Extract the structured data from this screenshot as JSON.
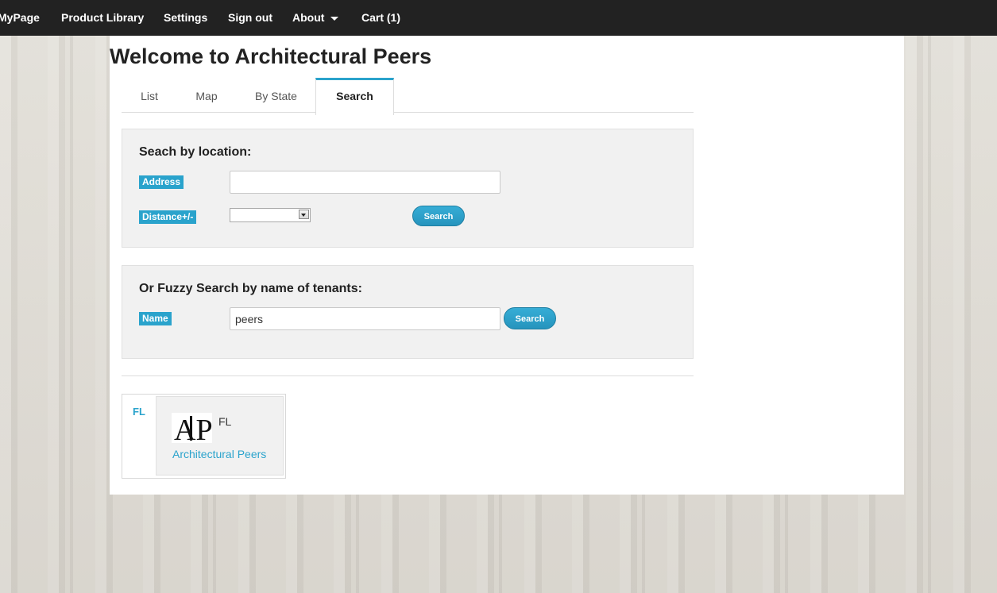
{
  "nav": {
    "mypage": "MyPage",
    "product_library": "Product Library",
    "settings": "Settings",
    "sign_out": "Sign out",
    "about": "About",
    "cart": "Cart (1)"
  },
  "page_title": "Welcome to Architectural Peers",
  "tabs": {
    "list": "List",
    "map": "Map",
    "by_state": "By State",
    "search": "Search",
    "active": "Search"
  },
  "location_search": {
    "title": "Seach by location:",
    "address_label": "Address",
    "address_value": "",
    "distance_label": "Distance+/-",
    "distance_value": "",
    "search_button": "Search"
  },
  "name_search": {
    "title": "Or Fuzzy Search by name of tenants:",
    "name_label": "Name",
    "name_value": "peers",
    "search_button": "Search"
  },
  "results": [
    {
      "state_group": "FL",
      "logo_text": "AP",
      "state": "FL",
      "name": "Architectural Peers"
    }
  ],
  "colors": {
    "accent": "#2aa3cc",
    "navbar": "#222222"
  }
}
